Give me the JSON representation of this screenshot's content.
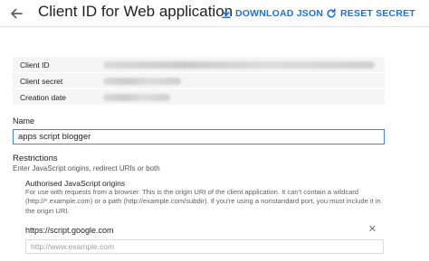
{
  "header": {
    "title": "Client ID for Web application",
    "download_label": "DOWNLOAD JSON",
    "reset_label": "RESET SECRET"
  },
  "credentials": {
    "rows": [
      {
        "label": "Client ID"
      },
      {
        "label": "Client secret"
      },
      {
        "label": "Creation date"
      }
    ]
  },
  "name": {
    "label": "Name",
    "value": "apps script blogger"
  },
  "restrictions": {
    "title": "Restrictions",
    "subtitle": "Enter JavaScript origins, redirect URIs or both",
    "origins": {
      "title": "Authorised JavaScript origins",
      "description": "For use with requests from a browser. This is the origin URI of the client application. It can't contain a wildcard (http://*.example.com) or a path (http://example.com/subdir). If you're using a nonstandard port, you must include it in the origin URI.",
      "items": [
        "https://script.google.com"
      ],
      "placeholder": "http://www.example.com"
    }
  },
  "colors": {
    "accent": "#1a73e8",
    "input_focus": "#4285f4",
    "table_bg": "#f5f5f5"
  },
  "icons": {
    "back": "arrow-back-icon",
    "download": "download-icon",
    "reset": "refresh-icon",
    "remove": "close-icon"
  }
}
